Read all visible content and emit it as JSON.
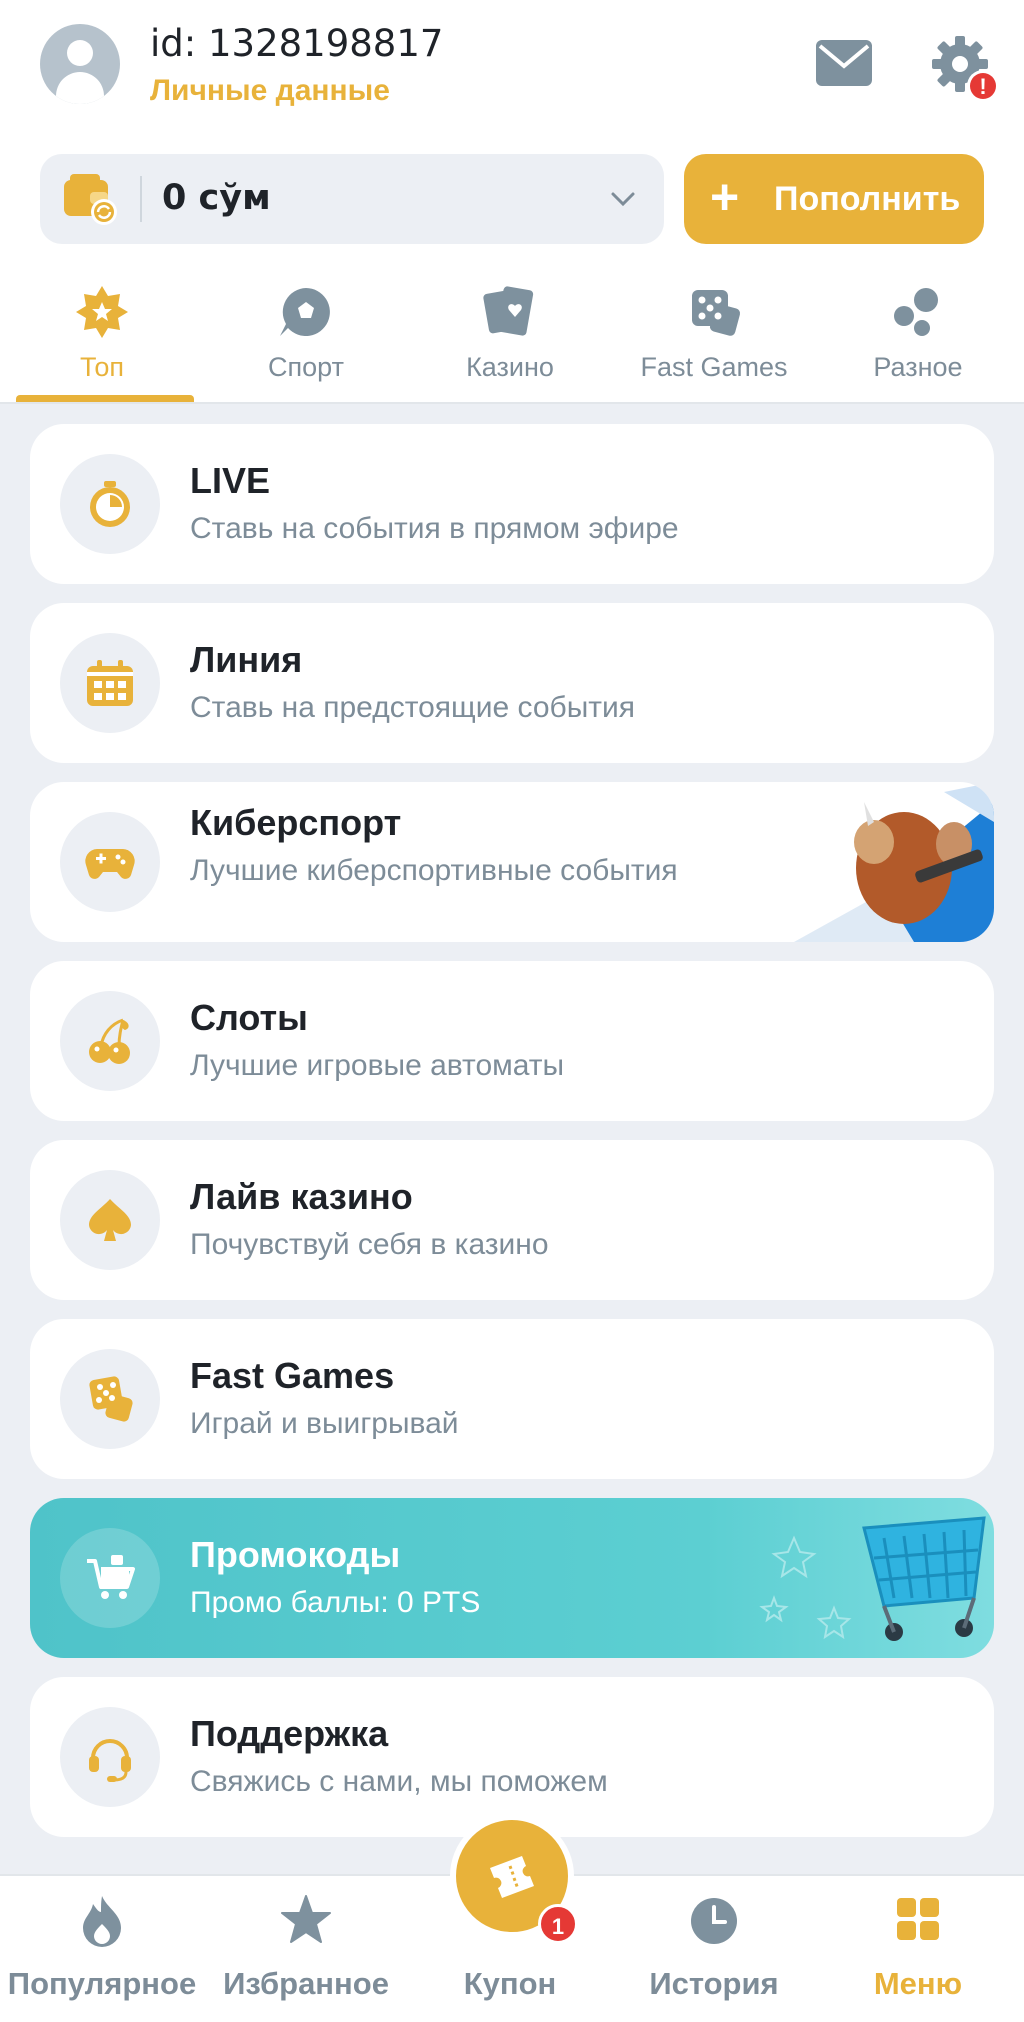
{
  "header": {
    "user_id": "id: 1328198817",
    "personal_data_link": "Личные данные",
    "settings_alert": "!"
  },
  "balance": {
    "value": "0 сўм",
    "deposit_plus": "+",
    "deposit_label": "Пополнить"
  },
  "tabs": [
    {
      "label": "Топ",
      "icon": "top-star-icon",
      "active": true
    },
    {
      "label": "Спорт",
      "icon": "sport-ball-icon",
      "active": false
    },
    {
      "label": "Казино",
      "icon": "casino-cards-icon",
      "active": false
    },
    {
      "label": "Fast Games",
      "icon": "dice-icon",
      "active": false
    },
    {
      "label": "Разное",
      "icon": "misc-dots-icon",
      "active": false
    }
  ],
  "menu": [
    {
      "title": "LIVE",
      "subtitle": "Ставь на события в прямом эфире",
      "icon": "stopwatch-icon"
    },
    {
      "title": "Линия",
      "subtitle": "Ставь на предстоящие события",
      "icon": "calendar-icon"
    },
    {
      "title": "Киберспорт",
      "subtitle": "Лучшие киберспортивные события",
      "icon": "gamepad-icon"
    },
    {
      "title": "Слоты",
      "subtitle": "Лучшие игровые автоматы",
      "icon": "cherry-icon"
    },
    {
      "title": "Лайв казино",
      "subtitle": "Почувствуй себя в казино",
      "icon": "spade-icon"
    },
    {
      "title": "Fast Games",
      "subtitle": "Играй и выигрывай",
      "icon": "dice-icon"
    },
    {
      "title": "Промокоды",
      "subtitle": "Промо баллы: 0 PTS",
      "icon": "cart-icon"
    },
    {
      "title": "Поддержка",
      "subtitle": "Свяжись с нами, мы поможем",
      "icon": "headset-icon"
    }
  ],
  "bottom_nav": [
    {
      "label": "Популярное",
      "icon": "flame-icon"
    },
    {
      "label": "Избранное",
      "icon": "star-icon"
    },
    {
      "label": "Купон",
      "icon": "ticket-icon",
      "badge": "1"
    },
    {
      "label": "История",
      "icon": "clock-icon"
    },
    {
      "label": "Меню",
      "icon": "grid-icon",
      "active": true
    }
  ],
  "colors": {
    "accent": "#e8b23a",
    "muted": "#7d8c98",
    "background": "#eceff4",
    "promo": "#4fc3c9",
    "badge": "#e53935"
  }
}
